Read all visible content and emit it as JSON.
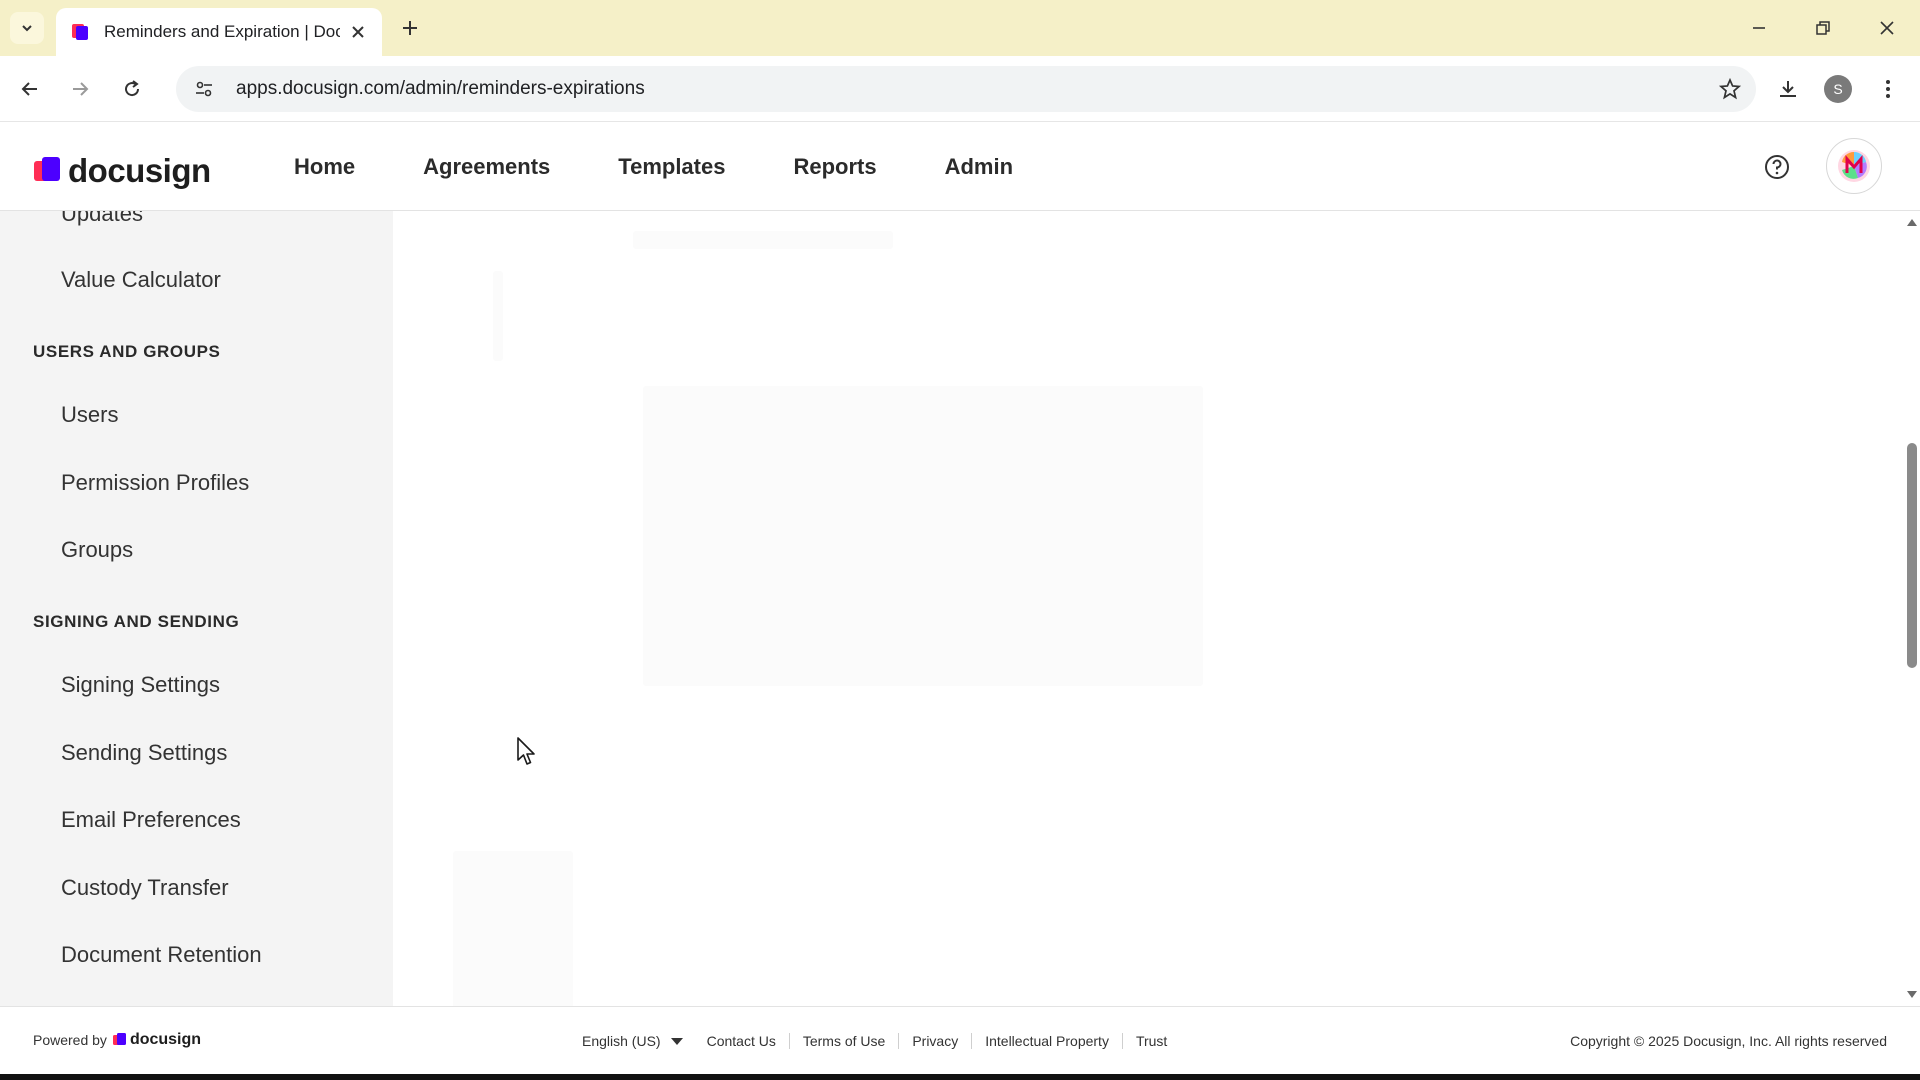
{
  "browser": {
    "tab_title": "Reminders and Expiration | Doc",
    "url": "apps.docusign.com/admin/reminders-expirations",
    "profile_initial": "S"
  },
  "app": {
    "logo_text": "docusign",
    "nav": [
      "Home",
      "Agreements",
      "Templates",
      "Reports",
      "Admin"
    ]
  },
  "sidebar": {
    "partial_item": "Updates",
    "items_top": [
      "Value Calculator"
    ],
    "section_users": "USERS AND GROUPS",
    "users_items": [
      "Users",
      "Permission Profiles",
      "Groups"
    ],
    "section_signing": "SIGNING AND SENDING",
    "signing_items": [
      "Signing Settings",
      "Sending Settings",
      "Email Preferences",
      "Custody Transfer",
      "Document Retention"
    ]
  },
  "footer": {
    "powered_by": "Powered by",
    "powered_logo": "docusign",
    "language": "English (US)",
    "links": [
      "Contact Us",
      "Terms of Use",
      "Privacy",
      "Intellectual Property",
      "Trust"
    ],
    "copyright": "Copyright © 2025 Docusign, Inc. All rights reserved"
  },
  "colors": {
    "tabbar_bg": "#f5f0c8",
    "sidebar_bg": "#f4f4f4",
    "brand_purple": "#4c00ff",
    "brand_red": "#ff2d55"
  }
}
